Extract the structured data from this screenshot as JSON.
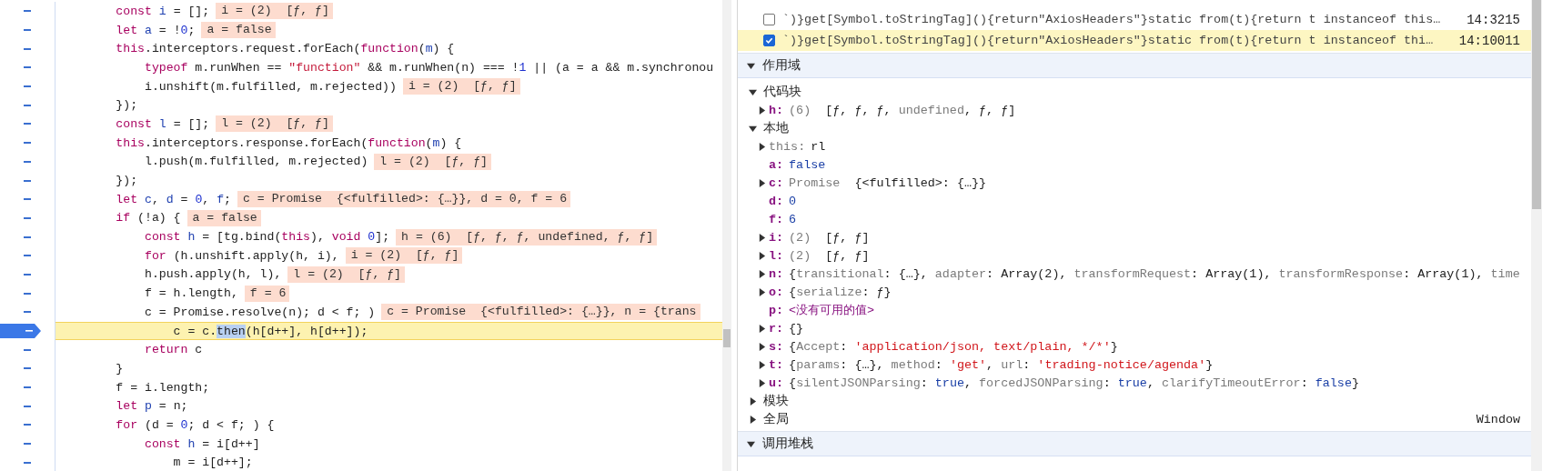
{
  "editor": {
    "lines": [
      {
        "current": false,
        "tokens": [
          {
            "kind": "keyword",
            "text": "        const"
          },
          {
            "kind": "def",
            "text": " i"
          },
          {
            "kind": "plain",
            "text": " = [];"
          }
        ],
        "inline_value": "i = (2)  [ƒ, ƒ]"
      },
      {
        "current": false,
        "tokens": [
          {
            "kind": "keyword",
            "text": "        let"
          },
          {
            "kind": "def",
            "text": " a"
          },
          {
            "kind": "plain",
            "text": " = !"
          },
          {
            "kind": "number",
            "text": "0"
          },
          {
            "kind": "plain",
            "text": ";"
          }
        ],
        "inline_value": "a = false"
      },
      {
        "current": false,
        "tokens": [
          {
            "kind": "keyword",
            "text": "        this"
          },
          {
            "kind": "plain",
            "text": ".interceptors.request.forEach("
          },
          {
            "kind": "keyword",
            "text": "function"
          },
          {
            "kind": "plain",
            "text": "("
          },
          {
            "kind": "def",
            "text": "m"
          },
          {
            "kind": "plain",
            "text": ") {"
          }
        ]
      },
      {
        "current": false,
        "tokens": [
          {
            "kind": "keyword",
            "text": "            typeof"
          },
          {
            "kind": "plain",
            "text": " m.runWhen == "
          },
          {
            "kind": "string",
            "text": "\"function\""
          },
          {
            "kind": "plain",
            "text": " && m.runWhen(n) === !"
          },
          {
            "kind": "number",
            "text": "1"
          },
          {
            "kind": "plain",
            "text": " || (a = a && m.synchronou"
          }
        ]
      },
      {
        "current": false,
        "tokens": [
          {
            "kind": "plain",
            "text": "            i.unshift(m.fulfilled, m.rejected))"
          }
        ],
        "inline_value": "i = (2)  [ƒ, ƒ]"
      },
      {
        "current": false,
        "tokens": [
          {
            "kind": "plain",
            "text": "        });"
          }
        ]
      },
      {
        "current": false,
        "tokens": [
          {
            "kind": "keyword",
            "text": "        const"
          },
          {
            "kind": "def",
            "text": " l"
          },
          {
            "kind": "plain",
            "text": " = [];"
          }
        ],
        "inline_value": "l = (2)  [ƒ, ƒ]"
      },
      {
        "current": false,
        "tokens": [
          {
            "kind": "keyword",
            "text": "        this"
          },
          {
            "kind": "plain",
            "text": ".interceptors.response.forEach("
          },
          {
            "kind": "keyword",
            "text": "function"
          },
          {
            "kind": "plain",
            "text": "("
          },
          {
            "kind": "def",
            "text": "m"
          },
          {
            "kind": "plain",
            "text": ") {"
          }
        ]
      },
      {
        "current": false,
        "tokens": [
          {
            "kind": "plain",
            "text": "            l.push(m.fulfilled, m.rejected)"
          }
        ],
        "inline_value": "l = (2)  [ƒ, ƒ]"
      },
      {
        "current": false,
        "tokens": [
          {
            "kind": "plain",
            "text": "        });"
          }
        ]
      },
      {
        "current": false,
        "tokens": [
          {
            "kind": "keyword",
            "text": "        let"
          },
          {
            "kind": "def",
            "text": " c"
          },
          {
            "kind": "plain",
            "text": ", "
          },
          {
            "kind": "def",
            "text": "d"
          },
          {
            "kind": "plain",
            "text": " = "
          },
          {
            "kind": "number",
            "text": "0"
          },
          {
            "kind": "plain",
            "text": ", "
          },
          {
            "kind": "def",
            "text": "f"
          },
          {
            "kind": "plain",
            "text": ";"
          }
        ],
        "inline_value": "c = Promise  {<fulfilled>: {…}}, d = 0, f = 6"
      },
      {
        "current": false,
        "tokens": [
          {
            "kind": "keyword",
            "text": "        if"
          },
          {
            "kind": "plain",
            "text": " (!a) {"
          }
        ],
        "inline_value": "a = false"
      },
      {
        "current": false,
        "tokens": [
          {
            "kind": "keyword",
            "text": "            const"
          },
          {
            "kind": "def",
            "text": " h"
          },
          {
            "kind": "plain",
            "text": " = [tg.bind("
          },
          {
            "kind": "keyword",
            "text": "this"
          },
          {
            "kind": "plain",
            "text": "), "
          },
          {
            "kind": "keyword",
            "text": "void"
          },
          {
            "kind": "number",
            "text": " 0"
          },
          {
            "kind": "plain",
            "text": "];"
          }
        ],
        "inline_value": "h = (6)  [ƒ, ƒ, ƒ, undefined, ƒ, ƒ]"
      },
      {
        "current": false,
        "tokens": [
          {
            "kind": "keyword",
            "text": "            for"
          },
          {
            "kind": "plain",
            "text": " (h.unshift.apply(h, i),"
          }
        ],
        "inline_value": "i = (2)  [ƒ, ƒ]"
      },
      {
        "current": false,
        "tokens": [
          {
            "kind": "plain",
            "text": "            h.push.apply(h, l),"
          }
        ],
        "inline_value": "l = (2)  [ƒ, ƒ]"
      },
      {
        "current": false,
        "tokens": [
          {
            "kind": "plain",
            "text": "            f = h.length,"
          }
        ],
        "inline_value": "f = 6"
      },
      {
        "current": false,
        "tokens": [
          {
            "kind": "plain",
            "text": "            c = Promise.resolve(n); d < f; )"
          }
        ],
        "inline_value": "c = Promise  {<fulfilled>: {…}}, n = {trans"
      },
      {
        "current": true,
        "tokens": [
          {
            "kind": "plain",
            "text": "                c = c."
          },
          {
            "kind": "selection",
            "text": "then"
          },
          {
            "kind": "plain",
            "text": "(h[d++], h[d++]);"
          }
        ]
      },
      {
        "current": false,
        "tokens": [
          {
            "kind": "keyword",
            "text": "            return"
          },
          {
            "kind": "plain",
            "text": " c"
          }
        ]
      },
      {
        "current": false,
        "tokens": [
          {
            "kind": "plain",
            "text": "        }"
          }
        ]
      },
      {
        "current": false,
        "tokens": [
          {
            "kind": "plain",
            "text": "        f = i.length;"
          }
        ]
      },
      {
        "current": false,
        "tokens": [
          {
            "kind": "keyword",
            "text": "        let"
          },
          {
            "kind": "def",
            "text": " p"
          },
          {
            "kind": "plain",
            "text": " = n;"
          }
        ]
      },
      {
        "current": false,
        "tokens": [
          {
            "kind": "keyword",
            "text": "        for"
          },
          {
            "kind": "plain",
            "text": " (d = "
          },
          {
            "kind": "number",
            "text": "0"
          },
          {
            "kind": "plain",
            "text": "; d < f; ) {"
          }
        ]
      },
      {
        "current": false,
        "tokens": [
          {
            "kind": "keyword",
            "text": "            const"
          },
          {
            "kind": "def",
            "text": " h"
          },
          {
            "kind": "plain",
            "text": " = i[d++]"
          }
        ]
      },
      {
        "current": false,
        "tokens": [
          {
            "kind": "plain",
            "text": "                m = i[d++];"
          }
        ]
      }
    ]
  },
  "breakpoints": [
    {
      "checked": false,
      "active": false,
      "text": "`)}get[Symbol.toStringTag](){return\"AxiosHeaders\"}static from(t){return t instanceof this…",
      "location": "14:3215"
    },
    {
      "checked": true,
      "active": true,
      "text": "`)}get[Symbol.toStringTag](){return\"AxiosHeaders\"}static from(t){return t instanceof thi…",
      "location": "14:10011"
    }
  ],
  "scope_pane": {
    "title": "作用域",
    "expanded": true,
    "groups": [
      {
        "title": "代码块",
        "expanded": true,
        "variables": [
          {
            "name": "h:",
            "name_dimmed": false,
            "kind": "object",
            "expanded": false,
            "value": [
              {
                "kind": "gray",
                "text": "(6)"
              },
              {
                "kind": "plain",
                "text": "  [ƒ, ƒ, ƒ, "
              },
              {
                "kind": "gray",
                "text": "undefined"
              },
              {
                "kind": "plain",
                "text": ", ƒ, ƒ]"
              }
            ]
          }
        ]
      },
      {
        "title": "本地",
        "expanded": true,
        "variables": [
          {
            "name": "this:",
            "name_dimmed": true,
            "kind": "object",
            "expanded": false,
            "value": [
              {
                "kind": "plain",
                "text": "rl"
              }
            ]
          },
          {
            "name": "a:",
            "name_dimmed": false,
            "kind": "primitive",
            "value": [
              {
                "kind": "blue",
                "text": "false"
              }
            ]
          },
          {
            "name": "c:",
            "name_dimmed": false,
            "kind": "object",
            "expanded": false,
            "value": [
              {
                "kind": "gray",
                "text": "Promise"
              },
              {
                "kind": "plain",
                "text": "  {<fulfilled>: {…}}"
              }
            ]
          },
          {
            "name": "d:",
            "name_dimmed": false,
            "kind": "primitive",
            "value": [
              {
                "kind": "blue",
                "text": "0"
              }
            ]
          },
          {
            "name": "f:",
            "name_dimmed": false,
            "kind": "primitive",
            "value": [
              {
                "kind": "blue",
                "text": "6"
              }
            ]
          },
          {
            "name": "i:",
            "name_dimmed": false,
            "kind": "object",
            "expanded": false,
            "value": [
              {
                "kind": "gray",
                "text": "(2)"
              },
              {
                "kind": "plain",
                "text": "  [ƒ, ƒ]"
              }
            ]
          },
          {
            "name": "l:",
            "name_dimmed": false,
            "kind": "object",
            "expanded": false,
            "value": [
              {
                "kind": "gray",
                "text": "(2)"
              },
              {
                "kind": "plain",
                "text": "  [ƒ, ƒ]"
              }
            ]
          },
          {
            "name": "n:",
            "name_dimmed": false,
            "kind": "object",
            "expanded": false,
            "value": [
              {
                "kind": "plain",
                "text": "{"
              },
              {
                "kind": "gray",
                "text": "transitional"
              },
              {
                "kind": "plain",
                "text": ": {…}, "
              },
              {
                "kind": "gray",
                "text": "adapter"
              },
              {
                "kind": "plain",
                "text": ": Array(2), "
              },
              {
                "kind": "gray",
                "text": "transformRequest"
              },
              {
                "kind": "plain",
                "text": ": Array(1), "
              },
              {
                "kind": "gray",
                "text": "transformResponse"
              },
              {
                "kind": "plain",
                "text": ": Array(1), "
              },
              {
                "kind": "gray",
                "text": "time"
              }
            ]
          },
          {
            "name": "o:",
            "name_dimmed": false,
            "kind": "object",
            "expanded": false,
            "value": [
              {
                "kind": "plain",
                "text": "{"
              },
              {
                "kind": "gray",
                "text": "serialize"
              },
              {
                "kind": "plain",
                "text": ": ƒ}"
              }
            ]
          },
          {
            "name": "p:",
            "name_dimmed": false,
            "kind": "primitive",
            "value": [
              {
                "kind": "purple",
                "text": "<没有可用的值>"
              }
            ]
          },
          {
            "name": "r:",
            "name_dimmed": false,
            "kind": "object",
            "expanded": false,
            "value": [
              {
                "kind": "plain",
                "text": "{}"
              }
            ]
          },
          {
            "name": "s:",
            "name_dimmed": false,
            "kind": "object",
            "expanded": false,
            "value": [
              {
                "kind": "plain",
                "text": "{"
              },
              {
                "kind": "gray",
                "text": "Accept"
              },
              {
                "kind": "plain",
                "text": ": "
              },
              {
                "kind": "red",
                "text": "'application/json, text/plain, */*'"
              },
              {
                "kind": "plain",
                "text": "}"
              }
            ]
          },
          {
            "name": "t:",
            "name_dimmed": false,
            "kind": "object",
            "expanded": false,
            "value": [
              {
                "kind": "plain",
                "text": "{"
              },
              {
                "kind": "gray",
                "text": "params"
              },
              {
                "kind": "plain",
                "text": ": {…}, "
              },
              {
                "kind": "gray",
                "text": "method"
              },
              {
                "kind": "plain",
                "text": ": "
              },
              {
                "kind": "red",
                "text": "'get'"
              },
              {
                "kind": "plain",
                "text": ", "
              },
              {
                "kind": "gray",
                "text": "url"
              },
              {
                "kind": "plain",
                "text": ": "
              },
              {
                "kind": "red",
                "text": "'trading-notice/agenda'"
              },
              {
                "kind": "plain",
                "text": "}"
              }
            ]
          },
          {
            "name": "u:",
            "name_dimmed": false,
            "kind": "object",
            "expanded": false,
            "value": [
              {
                "kind": "plain",
                "text": "{"
              },
              {
                "kind": "gray",
                "text": "silentJSONParsing"
              },
              {
                "kind": "plain",
                "text": ": "
              },
              {
                "kind": "blue",
                "text": "true"
              },
              {
                "kind": "plain",
                "text": ", "
              },
              {
                "kind": "gray",
                "text": "forcedJSONParsing"
              },
              {
                "kind": "plain",
                "text": ": "
              },
              {
                "kind": "blue",
                "text": "true"
              },
              {
                "kind": "plain",
                "text": ", "
              },
              {
                "kind": "gray",
                "text": "clarifyTimeoutError"
              },
              {
                "kind": "plain",
                "text": ": "
              },
              {
                "kind": "blue",
                "text": "false"
              },
              {
                "kind": "plain",
                "text": "}"
              }
            ]
          }
        ]
      },
      {
        "title": "模块",
        "expanded": false
      },
      {
        "title": "全局",
        "expanded": false,
        "value": "Window"
      }
    ]
  },
  "call_stack_pane": {
    "title": "调用堆栈",
    "expanded": true
  }
}
